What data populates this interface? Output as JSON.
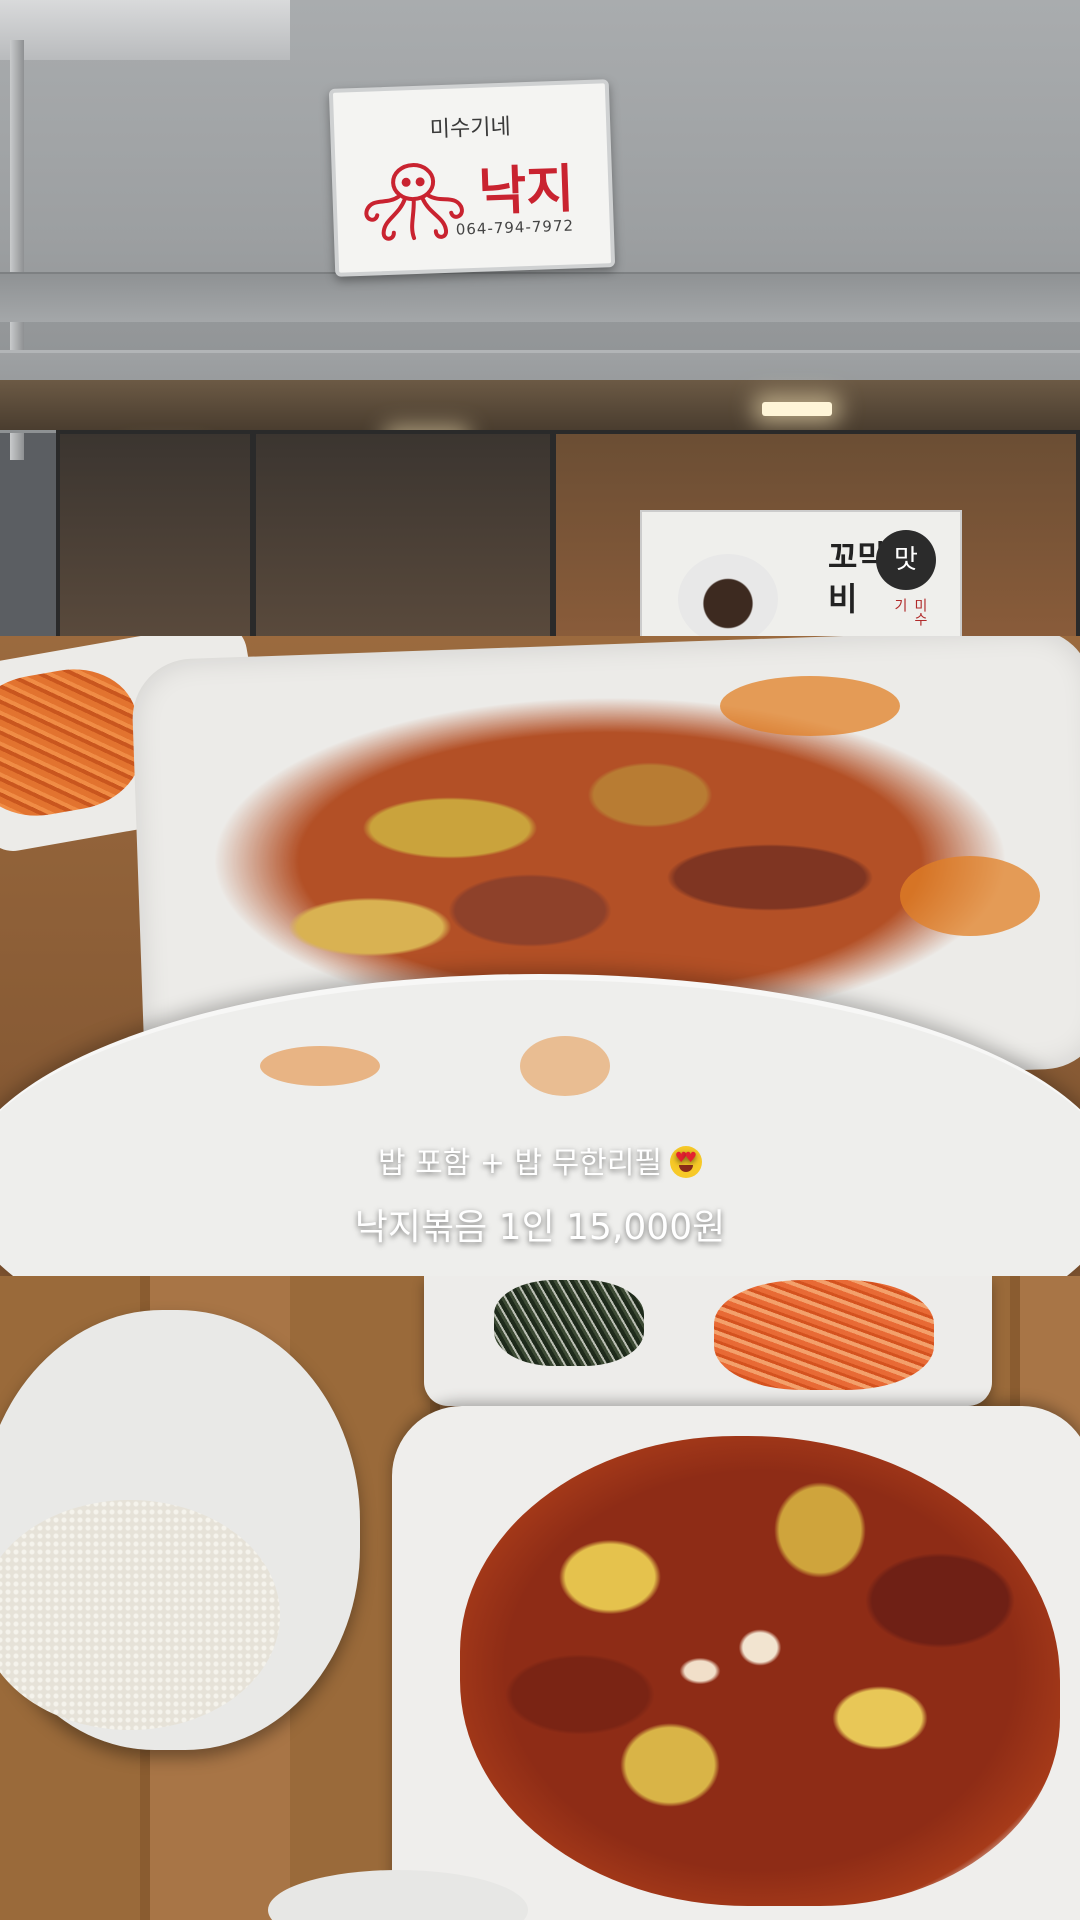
{
  "storefront": {
    "sign": {
      "name_top": "미수기네",
      "name_main": "낙지",
      "phone": "064-794-7972"
    },
    "poster": {
      "text": "꼬막비",
      "badge": "맛",
      "sub": "미수기"
    }
  },
  "caption": {
    "line1": "밥 포함 + 밥 무한리필",
    "line1_emoji": "heart-eyes-emoji",
    "line2": "낙지볶음 1인 15,000원"
  },
  "colors": {
    "sign_red": "#c92330",
    "caption_text": "#ffffff"
  }
}
